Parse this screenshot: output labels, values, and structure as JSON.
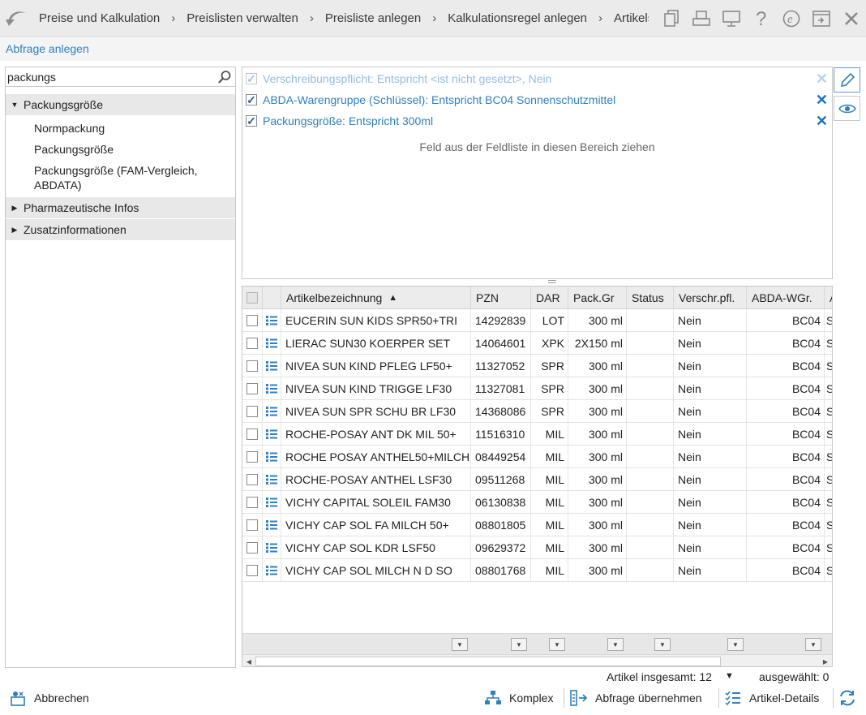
{
  "breadcrumbs": [
    "Preise und Kalkulation",
    "Preislisten verwalten",
    "Preisliste anlegen",
    "Kalkulationsregel anlegen",
    "Artikels"
  ],
  "subheader_title": "Abfrage anlegen",
  "search": {
    "value": "packungs"
  },
  "tree": {
    "group1": "Packungsgröße",
    "leaf1": "Normpackung",
    "leaf2": "Packungsgröße",
    "leaf3": "Packungsgröße (FAM-Vergleich, ABDATA)",
    "group2": "Pharmazeutische Infos",
    "group3": "Zusatzinformationen"
  },
  "filters": [
    {
      "text": "Verschreibungspflicht: Entspricht <ist nicht gesetzt>, Nein",
      "checked": true,
      "faded": true
    },
    {
      "text": "ABDA-Warengruppe (Schlüssel): Entspricht BC04 Sonnenschutzmittel",
      "checked": true,
      "faded": false
    },
    {
      "text": "Packungsgröße: Entspricht 300ml",
      "checked": true,
      "faded": false
    }
  ],
  "drop_hint": "Feld aus der Feldliste in diesen Bereich ziehen",
  "grid": {
    "columns": [
      "Artikelbezeichnung",
      "PZN",
      "DAR",
      "Pack.Gr",
      "Status",
      "Verschr.pfl.",
      "ABDA-WGr.",
      "A"
    ],
    "sort_indicator": "▲",
    "rows": [
      {
        "name": "EUCERIN SUN KIDS SPR50+TRI",
        "pzn": "14292839",
        "dar": "LOT",
        "pack": "300 ml",
        "status": "",
        "verschr": "Nein",
        "abda": "BC04",
        "extra": "S"
      },
      {
        "name": "LIERAC SUN30 KOERPER SET",
        "pzn": "14064601",
        "dar": "XPK",
        "pack": "2X150 ml",
        "status": "",
        "verschr": "Nein",
        "abda": "BC04",
        "extra": "S"
      },
      {
        "name": "NIVEA SUN KIND PFLEG LF50+",
        "pzn": "11327052",
        "dar": "SPR",
        "pack": "300 ml",
        "status": "",
        "verschr": "Nein",
        "abda": "BC04",
        "extra": "S"
      },
      {
        "name": "NIVEA SUN KIND TRIGGE LF30",
        "pzn": "11327081",
        "dar": "SPR",
        "pack": "300 ml",
        "status": "",
        "verschr": "Nein",
        "abda": "BC04",
        "extra": "S"
      },
      {
        "name": "NIVEA SUN SPR SCHU BR LF30",
        "pzn": "14368086",
        "dar": "SPR",
        "pack": "300 ml",
        "status": "",
        "verschr": "Nein",
        "abda": "BC04",
        "extra": "S"
      },
      {
        "name": "ROCHE-POSAY ANT DK MIL 50+",
        "pzn": "11516310",
        "dar": "MIL",
        "pack": "300 ml",
        "status": "",
        "verschr": "Nein",
        "abda": "BC04",
        "extra": "S"
      },
      {
        "name": "ROCHE POSAY ANTHEL50+MILCH",
        "pzn": "08449254",
        "dar": "MIL",
        "pack": "300 ml",
        "status": "",
        "verschr": "Nein",
        "abda": "BC04",
        "extra": "S"
      },
      {
        "name": "ROCHE-POSAY ANTHEL LSF30",
        "pzn": "09511268",
        "dar": "MIL",
        "pack": "300 ml",
        "status": "",
        "verschr": "Nein",
        "abda": "BC04",
        "extra": "S"
      },
      {
        "name": "VICHY CAPITAL SOLEIL FAM30",
        "pzn": "06130838",
        "dar": "MIL",
        "pack": "300 ml",
        "status": "",
        "verschr": "Nein",
        "abda": "BC04",
        "extra": "S"
      },
      {
        "name": "VICHY CAP SOL FA MILCH 50+",
        "pzn": "08801805",
        "dar": "MIL",
        "pack": "300 ml",
        "status": "",
        "verschr": "Nein",
        "abda": "BC04",
        "extra": "S"
      },
      {
        "name": "VICHY CAP SOL KDR LSF50",
        "pzn": "09629372",
        "dar": "MIL",
        "pack": "300 ml",
        "status": "",
        "verschr": "Nein",
        "abda": "BC04",
        "extra": "S"
      },
      {
        "name": "VICHY CAP SOL MILCH N D SO",
        "pzn": "08801768",
        "dar": "MIL",
        "pack": "300 ml",
        "status": "",
        "verschr": "Nein",
        "abda": "BC04",
        "extra": "S"
      }
    ]
  },
  "status": {
    "total": "Artikel insgesamt: 12",
    "selected": "ausgewählt: 0"
  },
  "footer": {
    "cancel": "Abbrechen",
    "complex": "Komplex",
    "apply_query": "Abfrage übernehmen",
    "article_details": "Artikel-Details"
  },
  "colors": {
    "accent": "#2f7fc1",
    "checkmark": "#1f5fa0"
  }
}
